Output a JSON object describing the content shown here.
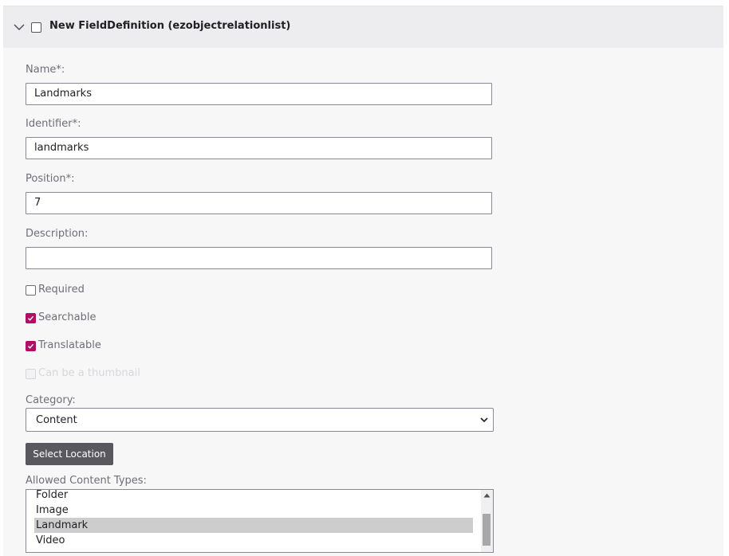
{
  "header": {
    "title": "New FieldDefinition (ezobjectrelationlist)"
  },
  "fields": {
    "name_label": "Name*:",
    "name_value": "Landmarks",
    "identifier_label": "Identifier*:",
    "identifier_value": "landmarks",
    "position_label": "Position*:",
    "position_value": "7",
    "description_label": "Description:",
    "description_value": ""
  },
  "checkboxes": {
    "required": {
      "label": "Required",
      "checked": false
    },
    "searchable": {
      "label": "Searchable",
      "checked": true
    },
    "translatable": {
      "label": "Translatable",
      "checked": true
    },
    "thumbnail": {
      "label": "Can be a thumbnail",
      "checked": false,
      "disabled": true
    }
  },
  "category": {
    "label": "Category:",
    "selected": "Content"
  },
  "select_location_button": "Select Location",
  "allowed_content_types": {
    "label": "Allowed Content Types:",
    "items": [
      "Folder",
      "Image",
      "Landmark",
      "Video"
    ],
    "selected": "Landmark"
  },
  "colors": {
    "accent": "#ae1164",
    "button": "#58585e",
    "header_bg": "#ededf0",
    "panel_bg": "#f7f7f8"
  }
}
